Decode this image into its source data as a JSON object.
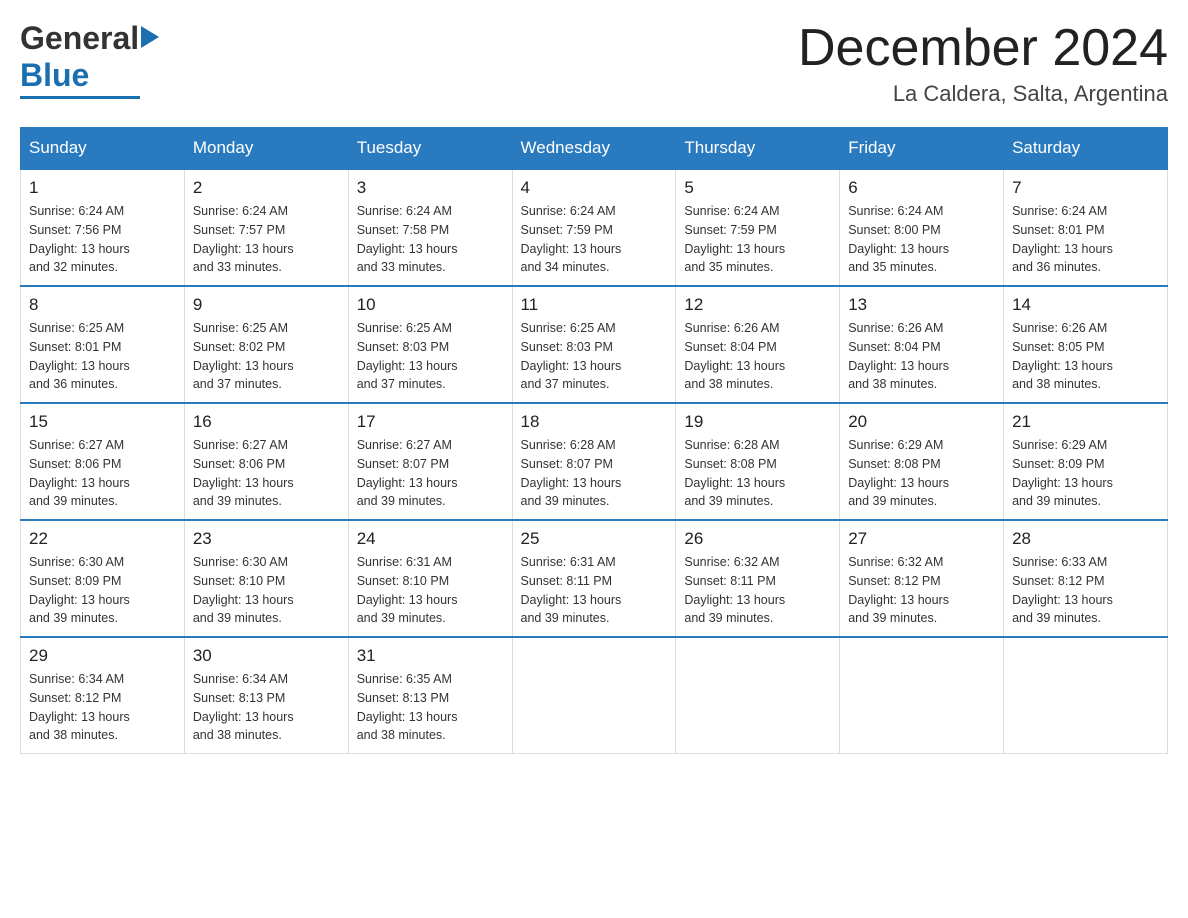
{
  "header": {
    "logo_general": "General",
    "logo_blue": "Blue",
    "month_title": "December 2024",
    "location": "La Caldera, Salta, Argentina"
  },
  "weekdays": [
    "Sunday",
    "Monday",
    "Tuesday",
    "Wednesday",
    "Thursday",
    "Friday",
    "Saturday"
  ],
  "weeks": [
    [
      {
        "day": "1",
        "sunrise": "6:24 AM",
        "sunset": "7:56 PM",
        "daylight": "13 hours and 32 minutes."
      },
      {
        "day": "2",
        "sunrise": "6:24 AM",
        "sunset": "7:57 PM",
        "daylight": "13 hours and 33 minutes."
      },
      {
        "day": "3",
        "sunrise": "6:24 AM",
        "sunset": "7:58 PM",
        "daylight": "13 hours and 33 minutes."
      },
      {
        "day": "4",
        "sunrise": "6:24 AM",
        "sunset": "7:59 PM",
        "daylight": "13 hours and 34 minutes."
      },
      {
        "day": "5",
        "sunrise": "6:24 AM",
        "sunset": "7:59 PM",
        "daylight": "13 hours and 35 minutes."
      },
      {
        "day": "6",
        "sunrise": "6:24 AM",
        "sunset": "8:00 PM",
        "daylight": "13 hours and 35 minutes."
      },
      {
        "day": "7",
        "sunrise": "6:24 AM",
        "sunset": "8:01 PM",
        "daylight": "13 hours and 36 minutes."
      }
    ],
    [
      {
        "day": "8",
        "sunrise": "6:25 AM",
        "sunset": "8:01 PM",
        "daylight": "13 hours and 36 minutes."
      },
      {
        "day": "9",
        "sunrise": "6:25 AM",
        "sunset": "8:02 PM",
        "daylight": "13 hours and 37 minutes."
      },
      {
        "day": "10",
        "sunrise": "6:25 AM",
        "sunset": "8:03 PM",
        "daylight": "13 hours and 37 minutes."
      },
      {
        "day": "11",
        "sunrise": "6:25 AM",
        "sunset": "8:03 PM",
        "daylight": "13 hours and 37 minutes."
      },
      {
        "day": "12",
        "sunrise": "6:26 AM",
        "sunset": "8:04 PM",
        "daylight": "13 hours and 38 minutes."
      },
      {
        "day": "13",
        "sunrise": "6:26 AM",
        "sunset": "8:04 PM",
        "daylight": "13 hours and 38 minutes."
      },
      {
        "day": "14",
        "sunrise": "6:26 AM",
        "sunset": "8:05 PM",
        "daylight": "13 hours and 38 minutes."
      }
    ],
    [
      {
        "day": "15",
        "sunrise": "6:27 AM",
        "sunset": "8:06 PM",
        "daylight": "13 hours and 39 minutes."
      },
      {
        "day": "16",
        "sunrise": "6:27 AM",
        "sunset": "8:06 PM",
        "daylight": "13 hours and 39 minutes."
      },
      {
        "day": "17",
        "sunrise": "6:27 AM",
        "sunset": "8:07 PM",
        "daylight": "13 hours and 39 minutes."
      },
      {
        "day": "18",
        "sunrise": "6:28 AM",
        "sunset": "8:07 PM",
        "daylight": "13 hours and 39 minutes."
      },
      {
        "day": "19",
        "sunrise": "6:28 AM",
        "sunset": "8:08 PM",
        "daylight": "13 hours and 39 minutes."
      },
      {
        "day": "20",
        "sunrise": "6:29 AM",
        "sunset": "8:08 PM",
        "daylight": "13 hours and 39 minutes."
      },
      {
        "day": "21",
        "sunrise": "6:29 AM",
        "sunset": "8:09 PM",
        "daylight": "13 hours and 39 minutes."
      }
    ],
    [
      {
        "day": "22",
        "sunrise": "6:30 AM",
        "sunset": "8:09 PM",
        "daylight": "13 hours and 39 minutes."
      },
      {
        "day": "23",
        "sunrise": "6:30 AM",
        "sunset": "8:10 PM",
        "daylight": "13 hours and 39 minutes."
      },
      {
        "day": "24",
        "sunrise": "6:31 AM",
        "sunset": "8:10 PM",
        "daylight": "13 hours and 39 minutes."
      },
      {
        "day": "25",
        "sunrise": "6:31 AM",
        "sunset": "8:11 PM",
        "daylight": "13 hours and 39 minutes."
      },
      {
        "day": "26",
        "sunrise": "6:32 AM",
        "sunset": "8:11 PM",
        "daylight": "13 hours and 39 minutes."
      },
      {
        "day": "27",
        "sunrise": "6:32 AM",
        "sunset": "8:12 PM",
        "daylight": "13 hours and 39 minutes."
      },
      {
        "day": "28",
        "sunrise": "6:33 AM",
        "sunset": "8:12 PM",
        "daylight": "13 hours and 39 minutes."
      }
    ],
    [
      {
        "day": "29",
        "sunrise": "6:34 AM",
        "sunset": "8:12 PM",
        "daylight": "13 hours and 38 minutes."
      },
      {
        "day": "30",
        "sunrise": "6:34 AM",
        "sunset": "8:13 PM",
        "daylight": "13 hours and 38 minutes."
      },
      {
        "day": "31",
        "sunrise": "6:35 AM",
        "sunset": "8:13 PM",
        "daylight": "13 hours and 38 minutes."
      },
      null,
      null,
      null,
      null
    ]
  ],
  "labels": {
    "sunrise": "Sunrise:",
    "sunset": "Sunset:",
    "daylight": "Daylight:"
  }
}
